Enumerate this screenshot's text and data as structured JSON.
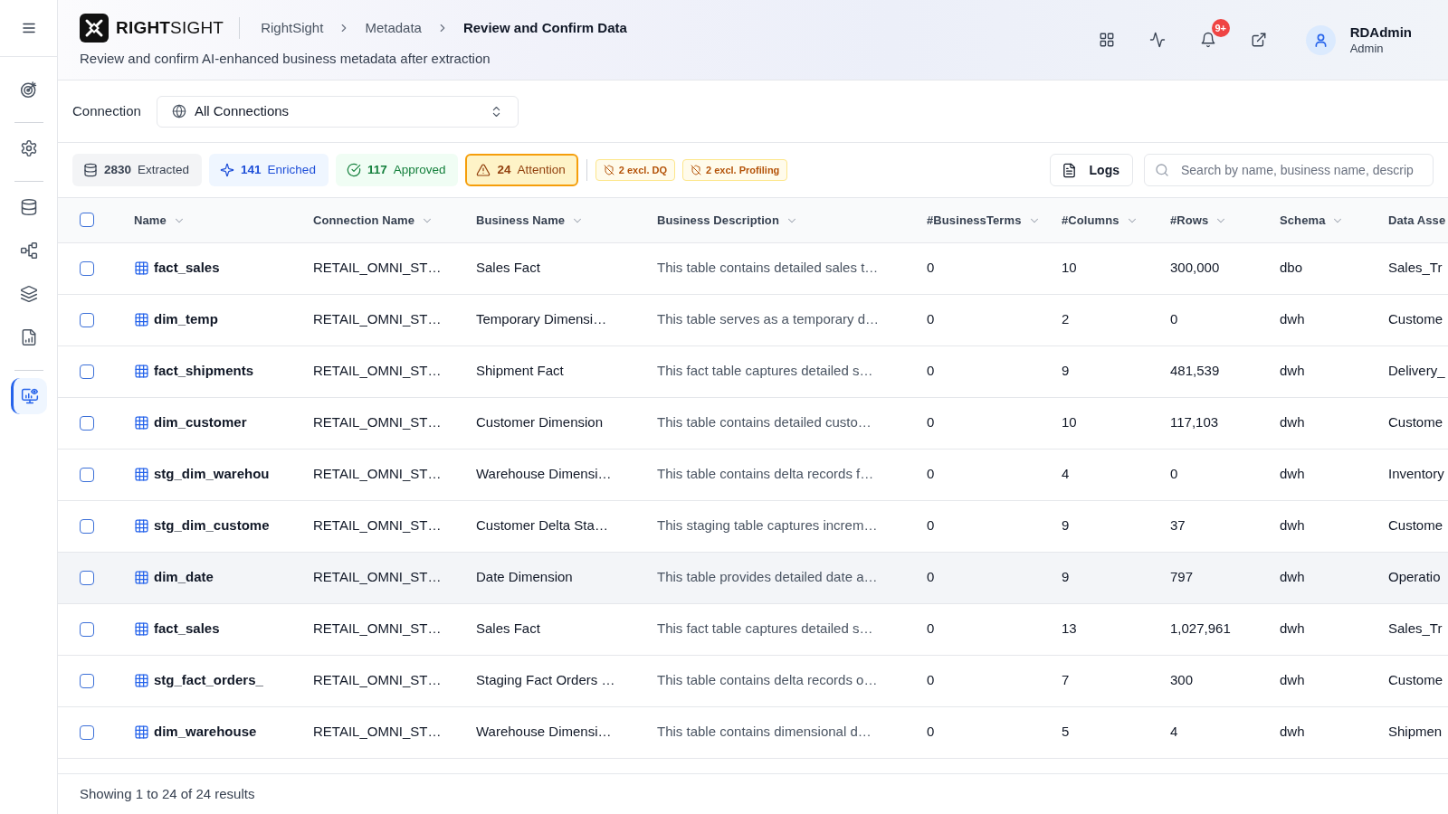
{
  "sidebar": {
    "groups": [
      {
        "items": [
          {
            "selected": false
          }
        ]
      },
      {
        "items": [
          {
            "selected": false
          }
        ]
      },
      {
        "items": [
          {
            "selected": false
          },
          {
            "selected": false
          },
          {
            "selected": false
          },
          {
            "selected": false
          }
        ]
      },
      {
        "items": [
          {
            "selected": true
          }
        ]
      }
    ]
  },
  "header": {
    "brand": "**RIGHT**SIGHT",
    "breadcrumbs": [
      {
        "label": "RightSight",
        "current": false
      },
      {
        "label": "Metadata",
        "current": false
      },
      {
        "label": "Review and Confirm Data",
        "current": true
      }
    ],
    "subtitle": "Review and confirm AI-enhanced business metadata after extraction",
    "notification_badge": "9+",
    "user": {
      "name": "RDAdmin",
      "role": "Admin"
    }
  },
  "connection_filter": {
    "label": "Connection",
    "value": "All Connections"
  },
  "status_filters": [
    {
      "kind": "extracted",
      "count": "2830",
      "label": "Extracted",
      "selected": false
    },
    {
      "kind": "enriched",
      "count": "141",
      "label": "Enriched",
      "selected": false
    },
    {
      "kind": "approved",
      "count": "117",
      "label": "Approved",
      "selected": false
    },
    {
      "kind": "attention",
      "count": "24",
      "label": "Attention",
      "selected": true
    }
  ],
  "exclusions": [
    {
      "label": "2 excl. DQ"
    },
    {
      "label": "2 excl. Profiling"
    }
  ],
  "logs_button": {
    "label": "Logs"
  },
  "search": {
    "placeholder": "Search by name, business name, descrip"
  },
  "table": {
    "select_all": {
      "checked": false
    },
    "columns": [
      {
        "label": "Name",
        "sortable": true
      },
      {
        "label": "Connection Name",
        "sortable": true
      },
      {
        "label": "Business Name",
        "sortable": true
      },
      {
        "label": "Business Description",
        "sortable": true
      },
      {
        "label": "#BusinessTerms",
        "sortable": true
      },
      {
        "label": "#Columns",
        "sortable": true
      },
      {
        "label": "#Rows",
        "sortable": true
      },
      {
        "label": "Schema",
        "sortable": true
      },
      {
        "label": "Data Asse",
        "sortable": false
      }
    ],
    "rows": [
      {
        "checked": false,
        "hovered": false,
        "name": "fact_sales",
        "connection": "RETAIL_OMNI_ST…",
        "business_name": "Sales Fact",
        "description": "This table contains detailed sales t…",
        "business_terms": "0",
        "columns": "10",
        "rows": "300,000",
        "schema": "dbo",
        "data_asset": "Sales_Tr"
      },
      {
        "checked": false,
        "hovered": false,
        "name": "dim_temp",
        "connection": "RETAIL_OMNI_ST…",
        "business_name": "Temporary Dimensi…",
        "description": "This table serves as a temporary d…",
        "business_terms": "0",
        "columns": "2",
        "rows": "0",
        "schema": "dwh",
        "data_asset": "Custome"
      },
      {
        "checked": false,
        "hovered": false,
        "name": "fact_shipments",
        "connection": "RETAIL_OMNI_ST…",
        "business_name": "Shipment Fact",
        "description": "This fact table captures detailed s…",
        "business_terms": "0",
        "columns": "9",
        "rows": "481,539",
        "schema": "dwh",
        "data_asset": "Delivery_"
      },
      {
        "checked": false,
        "hovered": false,
        "name": "dim_customer",
        "connection": "RETAIL_OMNI_ST…",
        "business_name": "Customer Dimension",
        "description": "This table contains detailed custo…",
        "business_terms": "0",
        "columns": "10",
        "rows": "117,103",
        "schema": "dwh",
        "data_asset": "Custome"
      },
      {
        "checked": false,
        "hovered": false,
        "name": "stg_dim_warehou",
        "connection": "RETAIL_OMNI_ST…",
        "business_name": "Warehouse Dimensi…",
        "description": "This table contains delta records f…",
        "business_terms": "0",
        "columns": "4",
        "rows": "0",
        "schema": "dwh",
        "data_asset": "Inventory"
      },
      {
        "checked": false,
        "hovered": false,
        "name": "stg_dim_custome",
        "connection": "RETAIL_OMNI_ST…",
        "business_name": "Customer Delta Sta…",
        "description": "This staging table captures increm…",
        "business_terms": "0",
        "columns": "9",
        "rows": "37",
        "schema": "dwh",
        "data_asset": "Custome"
      },
      {
        "checked": false,
        "hovered": true,
        "name": "dim_date",
        "connection": "RETAIL_OMNI_ST…",
        "business_name": "Date Dimension",
        "description": "This table provides detailed date a…",
        "business_terms": "0",
        "columns": "9",
        "rows": "797",
        "schema": "dwh",
        "data_asset": "Operatio"
      },
      {
        "checked": false,
        "hovered": false,
        "name": "fact_sales",
        "connection": "RETAIL_OMNI_ST…",
        "business_name": "Sales Fact",
        "description": "This fact table captures detailed s…",
        "business_terms": "0",
        "columns": "13",
        "rows": "1,027,961",
        "schema": "dwh",
        "data_asset": "Sales_Tr"
      },
      {
        "checked": false,
        "hovered": false,
        "name": "stg_fact_orders_",
        "connection": "RETAIL_OMNI_ST…",
        "business_name": "Staging Fact Orders …",
        "description": "This table contains delta records o…",
        "business_terms": "0",
        "columns": "7",
        "rows": "300",
        "schema": "dwh",
        "data_asset": "Custome"
      },
      {
        "checked": false,
        "hovered": false,
        "name": "dim_warehouse",
        "connection": "RETAIL_OMNI_ST…",
        "business_name": "Warehouse Dimensi…",
        "description": "This table contains dimensional d…",
        "business_terms": "0",
        "columns": "5",
        "rows": "4",
        "schema": "dwh",
        "data_asset": "Shipmen"
      }
    ]
  },
  "footer": {
    "summary": "Showing 1 to 24 of 24 results"
  }
}
